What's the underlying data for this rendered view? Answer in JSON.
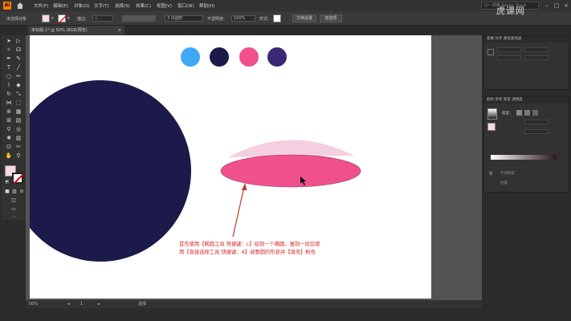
{
  "menubar": {
    "app_icon": "Ai",
    "items": [
      "文件(F)",
      "编辑(E)",
      "对象(O)",
      "文字(T)",
      "选择(S)",
      "效果(C)",
      "视图(V)",
      "窗口(W)",
      "帮助(H)"
    ],
    "search_placeholder": "Q~ 搜索 Adobe Stock"
  },
  "controlbar": {
    "selection_label": "未选择对象",
    "stroke_label": "描边:",
    "style_value": "3 点圆形",
    "opacity_label": "不透明度:",
    "opacity_value": "100%",
    "style_label": "样式:",
    "doc_setup_button": "文档设置",
    "preferences_button": "首选项"
  },
  "document_tab": {
    "label": "未标题-1* @ 50% (RGB/预览)",
    "close": "×"
  },
  "canvas": {
    "swatches": [
      "#3fa9f5",
      "#1b1a4a",
      "#f0508c",
      "#3a2a75"
    ],
    "big_circle_color": "#1b1a4a",
    "ellipse_fill": "#f0508c",
    "ellipse_top": "#f4cfe0",
    "annotation_line1": "首先使用【椭圆工具 快捷键：L】绘制一个椭圆，复制一层后使",
    "annotation_line2": "用【直接选择工具 快捷键：A】调整圆的形状并【填充】粉色",
    "annotation_color": "#d42a2a"
  },
  "statusbar": {
    "zoom": "50%",
    "page": "1",
    "tool_name": "选择"
  },
  "panels": {
    "transform_tabs": "变换  对齐  路径查找器",
    "gradient_tabs": "颜色  参考  渐变  透明度",
    "gradient_type_label": "类型：",
    "location_label": "不透明度",
    "position_label": "位置"
  },
  "watermark": "虎课网"
}
